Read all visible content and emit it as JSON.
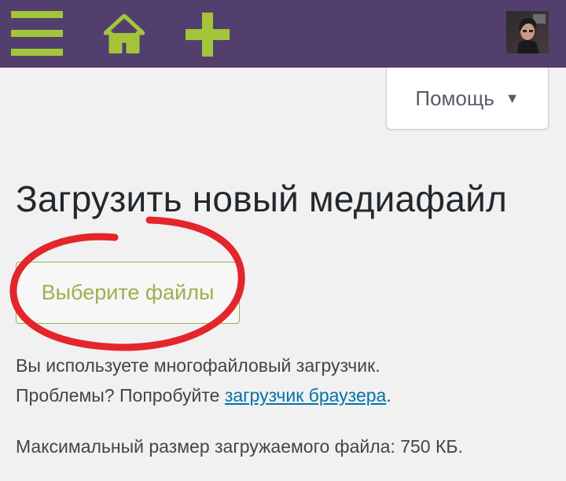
{
  "header": {
    "menu_icon": "hamburger-menu-icon",
    "home_icon": "home-icon",
    "add_icon": "plus-icon",
    "avatar": "user-avatar",
    "accent": "#a4c43b",
    "background": "#523f6d"
  },
  "help": {
    "label": "Помощь",
    "arrow": "▼"
  },
  "page": {
    "title": "Загрузить новый медиафайл"
  },
  "upload": {
    "select_files_label": "Выберите файлы",
    "button_color": "#9bb14f"
  },
  "info": {
    "multi_uploader": "Вы используете многофайловый загрузчик.",
    "problems_prefix": "Проблемы? Попробуйте ",
    "browser_uploader_link": "загрузчик браузера",
    "problems_suffix": ".",
    "max_size": "Максимальный размер загружаемого файла: 750 КБ."
  },
  "annotation": {
    "shape": "red-freehand-circle",
    "color": "#e4252b"
  }
}
